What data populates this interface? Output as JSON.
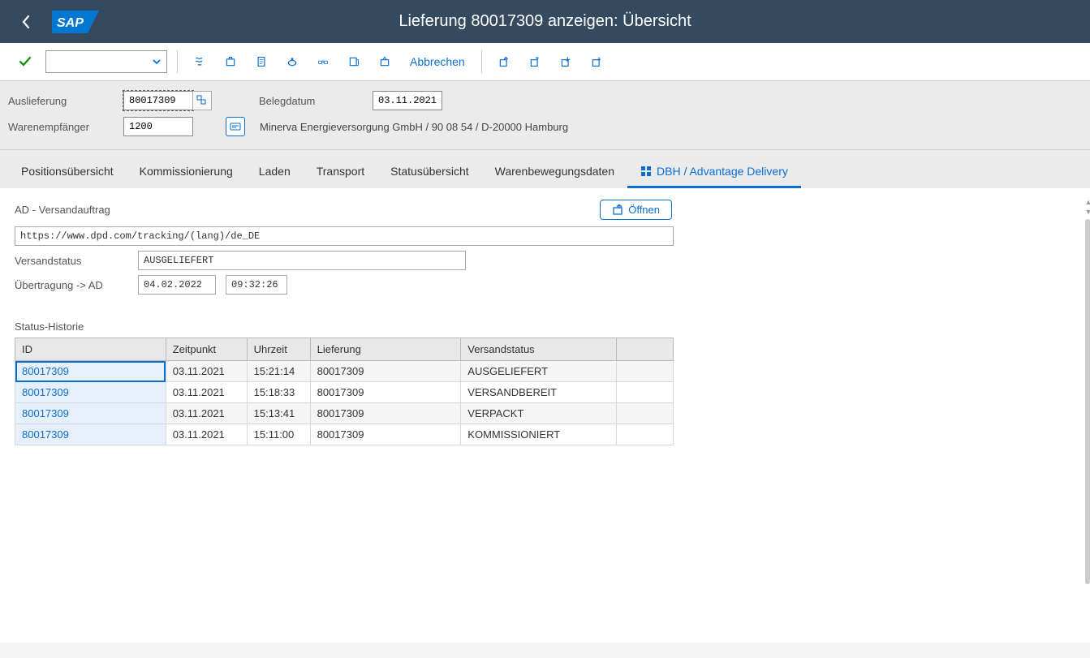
{
  "header": {
    "title": "Lieferung 80017309 anzeigen: Übersicht"
  },
  "toolbar": {
    "cancel_label": "Abbrechen"
  },
  "form": {
    "label_delivery": "Auslieferung",
    "delivery_value": "80017309",
    "label_docdate": "Belegdatum",
    "docdate_value": "03.11.2021",
    "label_shipto": "Warenempfänger",
    "shipto_value": "1200",
    "shipto_text": "Minerva Energieversorgung GmbH / 90 08 54 / D-20000 Hamburg"
  },
  "tabs": {
    "item_overview": "Positionsübersicht",
    "picking": "Kommissionierung",
    "loading": "Laden",
    "transport": "Transport",
    "status": "Statusübersicht",
    "goods_movement": "Warenbewegungsdaten",
    "dbh": "DBH / Advantage Delivery"
  },
  "adv": {
    "group_title": "AD - Versandauftrag",
    "open_label": "Öffnen",
    "tracking_url": "https://www.dpd.com/tracking/(lang)/de_DE",
    "label_status": "Versandstatus",
    "status_value": "AUSGELIEFERT",
    "label_transfer": "Übertragung -> AD",
    "transfer_date": "04.02.2022",
    "transfer_time": "09:32:26"
  },
  "history": {
    "label": "Status-Historie",
    "col_id": "ID",
    "col_time": "Zeitpunkt",
    "col_clock": "Uhrzeit",
    "col_delivery": "Lieferung",
    "col_status": "Versandstatus",
    "rows": [
      {
        "id": "80017309",
        "date": "03.11.2021",
        "time": "15:21:14",
        "delivery": "80017309",
        "status": "AUSGELIEFERT"
      },
      {
        "id": "80017309",
        "date": "03.11.2021",
        "time": "15:18:33",
        "delivery": "80017309",
        "status": "VERSANDBEREIT"
      },
      {
        "id": "80017309",
        "date": "03.11.2021",
        "time": "15:13:41",
        "delivery": "80017309",
        "status": "VERPACKT"
      },
      {
        "id": "80017309",
        "date": "03.11.2021",
        "time": "15:11:00",
        "delivery": "80017309",
        "status": "KOMMISSIONIERT"
      }
    ]
  }
}
